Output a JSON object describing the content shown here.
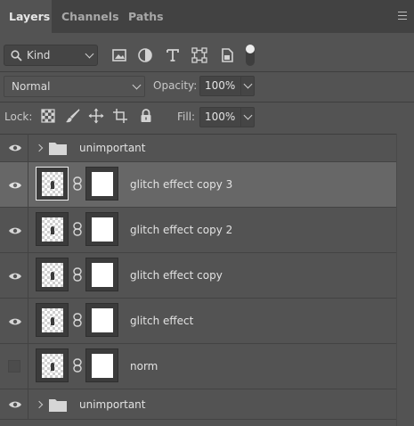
{
  "tabs": [
    {
      "label": "Layers",
      "active": true
    },
    {
      "label": "Channels",
      "active": false
    },
    {
      "label": "Paths",
      "active": false
    }
  ],
  "filter": {
    "kind_label": "Kind",
    "icons": [
      "image-filter-icon",
      "adjustment-filter-icon",
      "type-filter-icon",
      "shape-filter-icon",
      "smart-object-filter-icon"
    ]
  },
  "blend": {
    "mode": "Normal",
    "opacity_label": "Opacity:",
    "opacity_value": "100%"
  },
  "lock": {
    "label": "Lock:",
    "icons": [
      "lock-transparent-pixels-icon",
      "lock-image-pixels-icon",
      "lock-position-icon",
      "lock-artboard-icon",
      "lock-all-icon"
    ],
    "fill_label": "Fill:",
    "fill_value": "100%"
  },
  "layers": [
    {
      "name": "unimportant",
      "type": "group",
      "visible": true,
      "selected": false
    },
    {
      "name": "glitch effect copy 3",
      "type": "layer",
      "visible": true,
      "selected": true
    },
    {
      "name": "glitch effect copy 2",
      "type": "layer",
      "visible": true,
      "selected": false
    },
    {
      "name": "glitch effect copy",
      "type": "layer",
      "visible": true,
      "selected": false
    },
    {
      "name": "glitch effect",
      "type": "layer",
      "visible": true,
      "selected": false
    },
    {
      "name": "norm",
      "type": "layer",
      "visible": false,
      "selected": false
    },
    {
      "name": "unimportant",
      "type": "group",
      "visible": true,
      "selected": false
    }
  ],
  "colors": {
    "panel_bg": "#535353",
    "tabbar_bg": "#424242",
    "selected_row": "#676767",
    "text": "#e2e2e2"
  }
}
